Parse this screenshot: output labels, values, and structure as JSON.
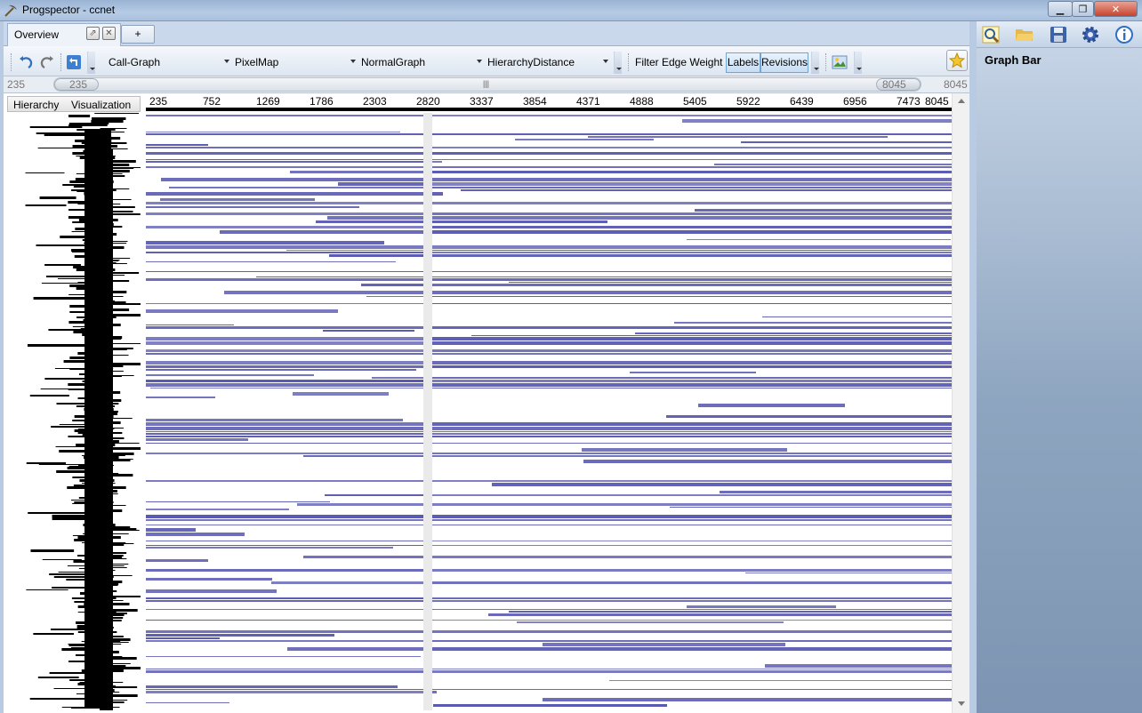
{
  "window": {
    "title": "Progspector - ccnet",
    "minimize": "▁",
    "maximize": "❐",
    "close": "✕"
  },
  "tabs": {
    "overview": "Overview",
    "add": "+"
  },
  "toolbar": {
    "graph_type": "Call-Graph",
    "visualization": "PixelMap",
    "graph_mode": "NormalGraph",
    "ordering": "HierarchyDistance",
    "filter_label": "Filter Edge Weight",
    "labels_toggle": "Labels",
    "revisions_toggle": "Revisions"
  },
  "range": {
    "min_label": "235",
    "left_thumb": "235",
    "right_thumb": "8045",
    "max_label": "8045",
    "grip": "|||"
  },
  "columns": {
    "hierarchy": "Hierarchy",
    "visualization": "Visualization"
  },
  "axis_ticks": [
    "235",
    "752",
    "1269",
    "1786",
    "2303",
    "2820",
    "3337",
    "3854",
    "4371",
    "4888",
    "5405",
    "5922",
    "6439",
    "6956",
    "7473",
    "8045"
  ],
  "graph_bar": {
    "title": "Graph Bar",
    "tools": [
      "search-icon",
      "open-folder-icon",
      "save-icon",
      "settings-gear-icon",
      "info-icon"
    ]
  },
  "colors": {
    "bar": "#5a5ab2",
    "accent": "#2f6fc2"
  }
}
